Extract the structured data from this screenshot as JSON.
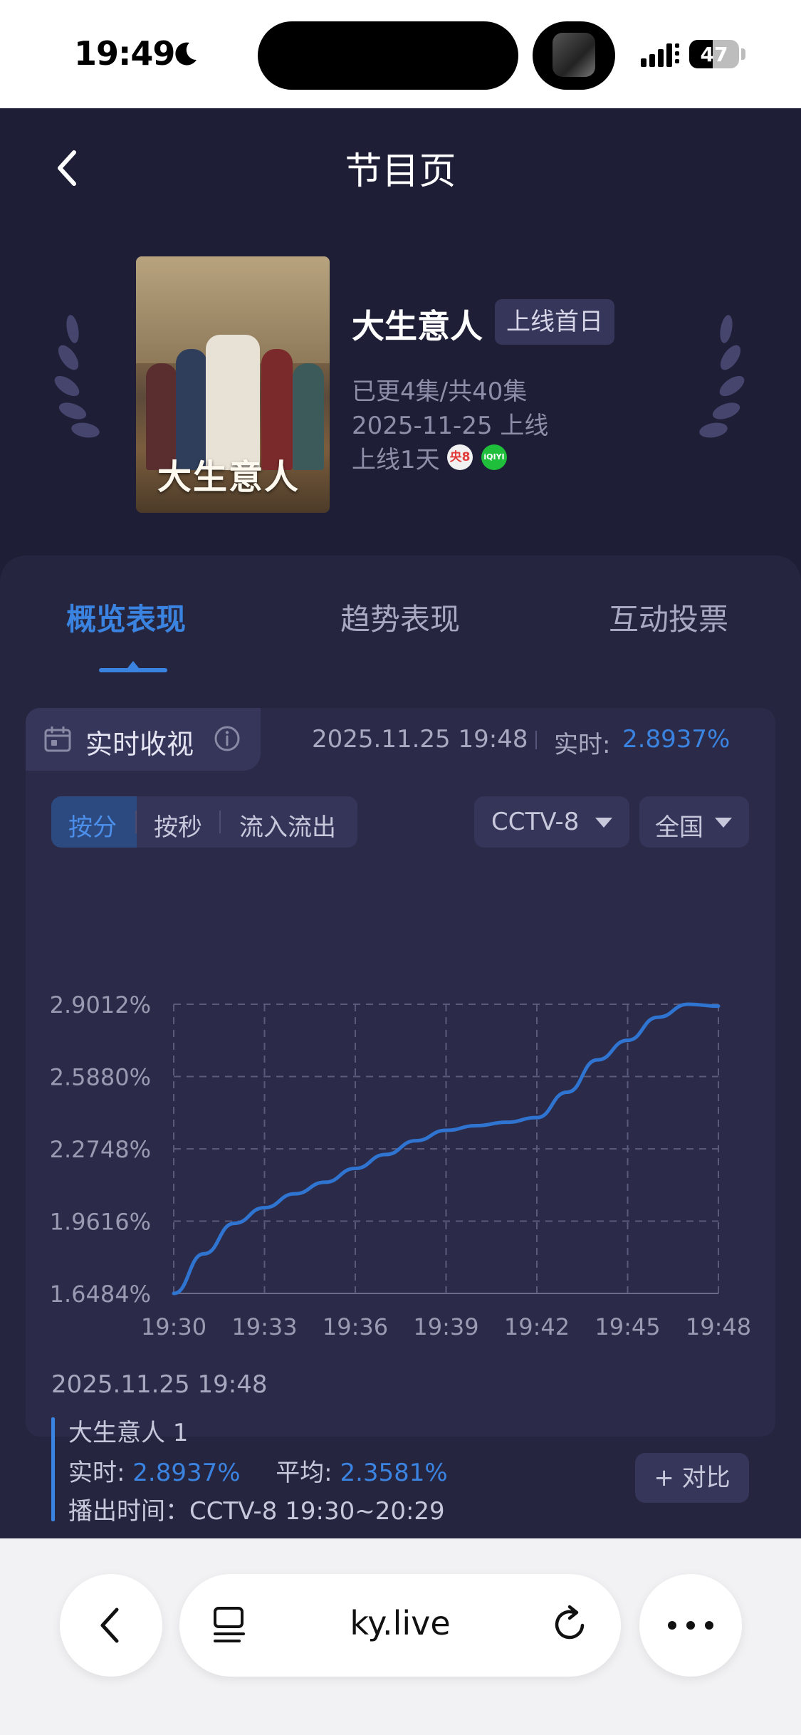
{
  "status_bar": {
    "time": "19:49",
    "battery": "47",
    "battery_level_percent": 47
  },
  "nav": {
    "title": "节目页"
  },
  "show": {
    "title": "大生意人",
    "badge": "上线首日",
    "episodes": "已更4集/共40集",
    "release": "2025-11-25 上线",
    "days_online": "上线1天",
    "poster_title": "大生意人",
    "platforms": [
      {
        "name": "cctv8-icon",
        "label": "央8",
        "color": "#e23b3b"
      },
      {
        "name": "iqiyi-icon",
        "label": "iQIYI",
        "color": "#1fbe3b"
      }
    ]
  },
  "tabs": [
    {
      "label": "概览表现",
      "active": true
    },
    {
      "label": "趋势表现",
      "active": false
    },
    {
      "label": "互动投票",
      "active": false
    }
  ],
  "realtime": {
    "label": "实时收视",
    "datetime": "2025.11.25 19:48",
    "live_label": "实时:",
    "live_value": "2.8937%"
  },
  "segments": [
    {
      "label": "按分",
      "active": true
    },
    {
      "label": "按秒",
      "active": false
    },
    {
      "label": "流入流出",
      "active": false
    }
  ],
  "filters": {
    "channel": "CCTV-8",
    "region": "全国"
  },
  "chart_data": {
    "type": "line",
    "x": [
      "19:30",
      "19:31",
      "19:32",
      "19:33",
      "19:34",
      "19:35",
      "19:36",
      "19:37",
      "19:38",
      "19:39",
      "19:40",
      "19:41",
      "19:42",
      "19:43",
      "19:44",
      "19:45",
      "19:46",
      "19:47",
      "19:48"
    ],
    "x_ticks": [
      "19:30",
      "19:33",
      "19:36",
      "19:39",
      "19:42",
      "19:45",
      "19:48"
    ],
    "y_ticks": [
      "2.9012%",
      "2.5880%",
      "2.2748%",
      "1.9616%",
      "1.6484%"
    ],
    "ylim": [
      1.6484,
      2.9012
    ],
    "grid": true,
    "series": [
      {
        "color": "#2f74d0",
        "values": [
          1.6484,
          1.82,
          1.952,
          2.02,
          2.08,
          2.13,
          2.19,
          2.25,
          2.31,
          2.355,
          2.375,
          2.39,
          2.41,
          2.52,
          2.66,
          2.745,
          2.845,
          2.9012,
          2.893
        ]
      }
    ]
  },
  "summary": {
    "datetime": "2025.11.25 19:48",
    "episode": "大生意人 1",
    "live_label": "实时:",
    "live_value": "2.8937%",
    "avg_label": "平均:",
    "avg_value": "2.3581%",
    "airtime": "播出时间：CCTV-8 19:30~20:29",
    "compare_button": "+ 对比"
  },
  "browser": {
    "url": "ky.live"
  }
}
